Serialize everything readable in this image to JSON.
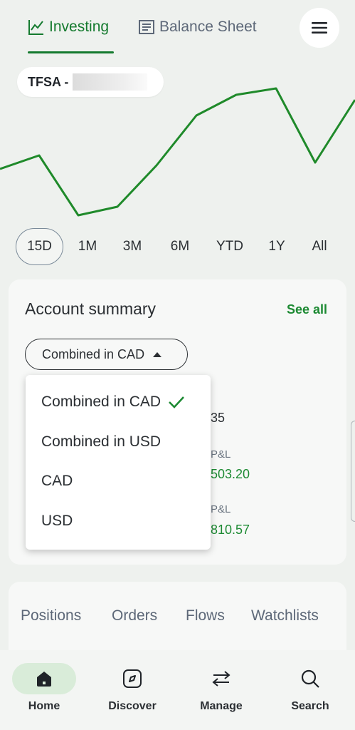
{
  "tabs": {
    "investing": "Investing",
    "balance_sheet": "Balance Sheet"
  },
  "account": {
    "label": "TFSA -",
    "masked_suffix": "-"
  },
  "ranges": [
    "15D",
    "1M",
    "3M",
    "6M",
    "YTD",
    "1Y",
    "All"
  ],
  "active_range": "15D",
  "summary": {
    "title": "Account summary",
    "see_all": "See all",
    "selected_currency": "Combined in CAD",
    "partial_value": "35",
    "pl_label_1": "P&L",
    "pl_value_1": "503.20",
    "pl_label_2": "P&L",
    "pl_value_2": "810.57"
  },
  "dropdown": {
    "options": [
      "Combined in CAD",
      "Combined in USD",
      "CAD",
      "USD"
    ],
    "selected": "Combined in CAD"
  },
  "lower_tabs": [
    "Positions",
    "Orders",
    "Flows",
    "Watchlists"
  ],
  "nav": {
    "home": "Home",
    "discover": "Discover",
    "manage": "Manage",
    "search": "Search"
  },
  "colors": {
    "accent": "#147a2e",
    "line": "#1f8a2a",
    "positive": "#1d8a33"
  }
}
